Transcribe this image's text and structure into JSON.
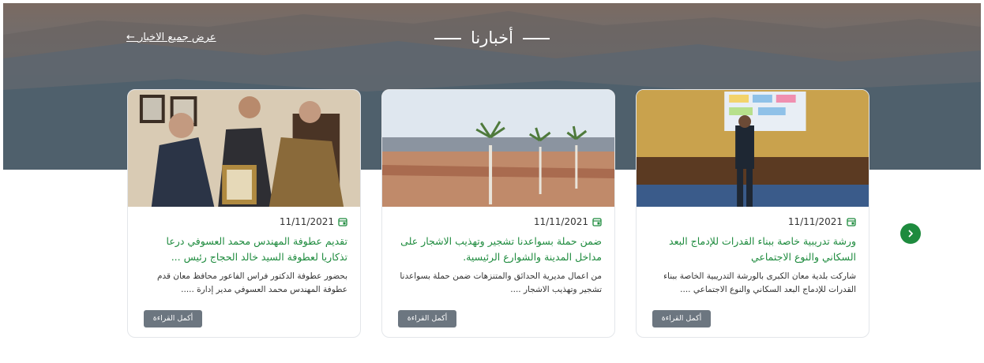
{
  "section": {
    "title": "أخبارنا",
    "view_all": "عرض جميع الاخبار ←"
  },
  "cards": [
    {
      "date": "11/11/2021",
      "title": "ورشة تدريبية خاصة ببناء القدرات للإدماج البعد السكاني والنوع الاجتماعي",
      "excerpt": "شاركت بلدية معان الكبرى بالورشة التدريبية الخاصة ببناء القدرات للإدماج البعد السكاني والنوع الاجتماعي ....",
      "read_more": "أكمل القراءة"
    },
    {
      "date": "11/11/2021",
      "title": "ضمن حملة بسواعدنا تشجير وتهذيب الاشجار على مداخل المدينة والشوارع الرئيسية.",
      "excerpt": "من اعمال مديرية الحدائق والمتنزهات ضمن حملة بسواعدنا تشجير وتهذيب الاشجار ....",
      "read_more": "أكمل القراءة"
    },
    {
      "date": "11/11/2021",
      "title": "تقديم عطوفة المهندس محمد العسوفي درعا تذكاريا لعطوفة السيد خالد الحجاج رئيس ...",
      "excerpt": "بحضور عطوفة الدكتور فراس الفاعور محافظ معان قدم عطوفة المهندس محمد العسوفي مدير إدارة .....",
      "read_more": "أكمل القراءة"
    }
  ],
  "icons": {
    "calendar": "calendar-icon",
    "next": "chevron-right-icon"
  },
  "colors": {
    "accent": "#1e8b3e",
    "button": "#6c7680"
  }
}
